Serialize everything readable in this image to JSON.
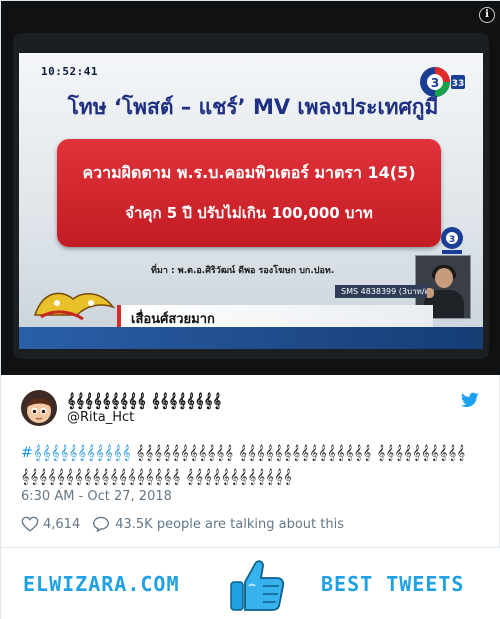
{
  "media": {
    "tv_clock": "10:52:41",
    "channel_logo": "ch3-logo",
    "headline": "โทษ ‘โพสต์ – แชร์’ MV เพลงประเทศกูมี",
    "red_box_line1": "ความผิดตาม พ.ร.บ.คอมพิวเตอร์ มาตรา 14(5)",
    "red_box_line2": "จำคุก 5 ปี  ปรับไม่เกิน 100,000 บาท",
    "source_line": "ที่มา : พ.ต.อ.ศิริวัฒน์ ดีพอ รองโฆษก บก.ปอท.",
    "sms_text": "SMS 4838399 (3บาท/ครั้ง)",
    "ticker_text": "เสื่อนศ์สวยมาก",
    "info_symbol": "i"
  },
  "tweet": {
    "display_name": "𝄞𝄞𝄞𝄞𝄞𝄞𝄞𝄞𝄞 𝄞𝄞𝄞𝄞𝄞𝄞𝄞𝄞",
    "handle": "@Rita_Hct",
    "hashtag": "#𝄞𝄞𝄞𝄞𝄞𝄞𝄞𝄞𝄞𝄞𝄞",
    "text_after_hashtag": " 𝄞𝄞𝄞𝄞𝄞𝄞𝄞𝄞𝄞𝄞𝄞 𝄞𝄞𝄞𝄞𝄞𝄞𝄞𝄞𝄞𝄞𝄞𝄞𝄞𝄞𝄞 𝄞𝄞𝄞𝄞𝄞𝄞𝄞𝄞𝄞𝄞 𝄞𝄞𝄞𝄞𝄞𝄞𝄞𝄞𝄞𝄞𝄞𝄞𝄞𝄞𝄞𝄞𝄞𝄞 𝄞𝄞𝄞𝄞𝄞𝄞𝄞𝄞𝄞𝄞𝄞𝄞",
    "timestamp": "6:30 AM - Oct 27, 2018",
    "like_count": "4,614",
    "talking_text": "43.5K people are talking about this"
  },
  "footer": {
    "site_name": "ELWIZARA.COM",
    "best_tweets": "BEST TWEETS"
  },
  "colors": {
    "twitter_blue": "#1da1f2",
    "brand_blue": "#1fa1e3",
    "hashtag_blue": "#1b95e0",
    "meta_gray": "#657786"
  }
}
